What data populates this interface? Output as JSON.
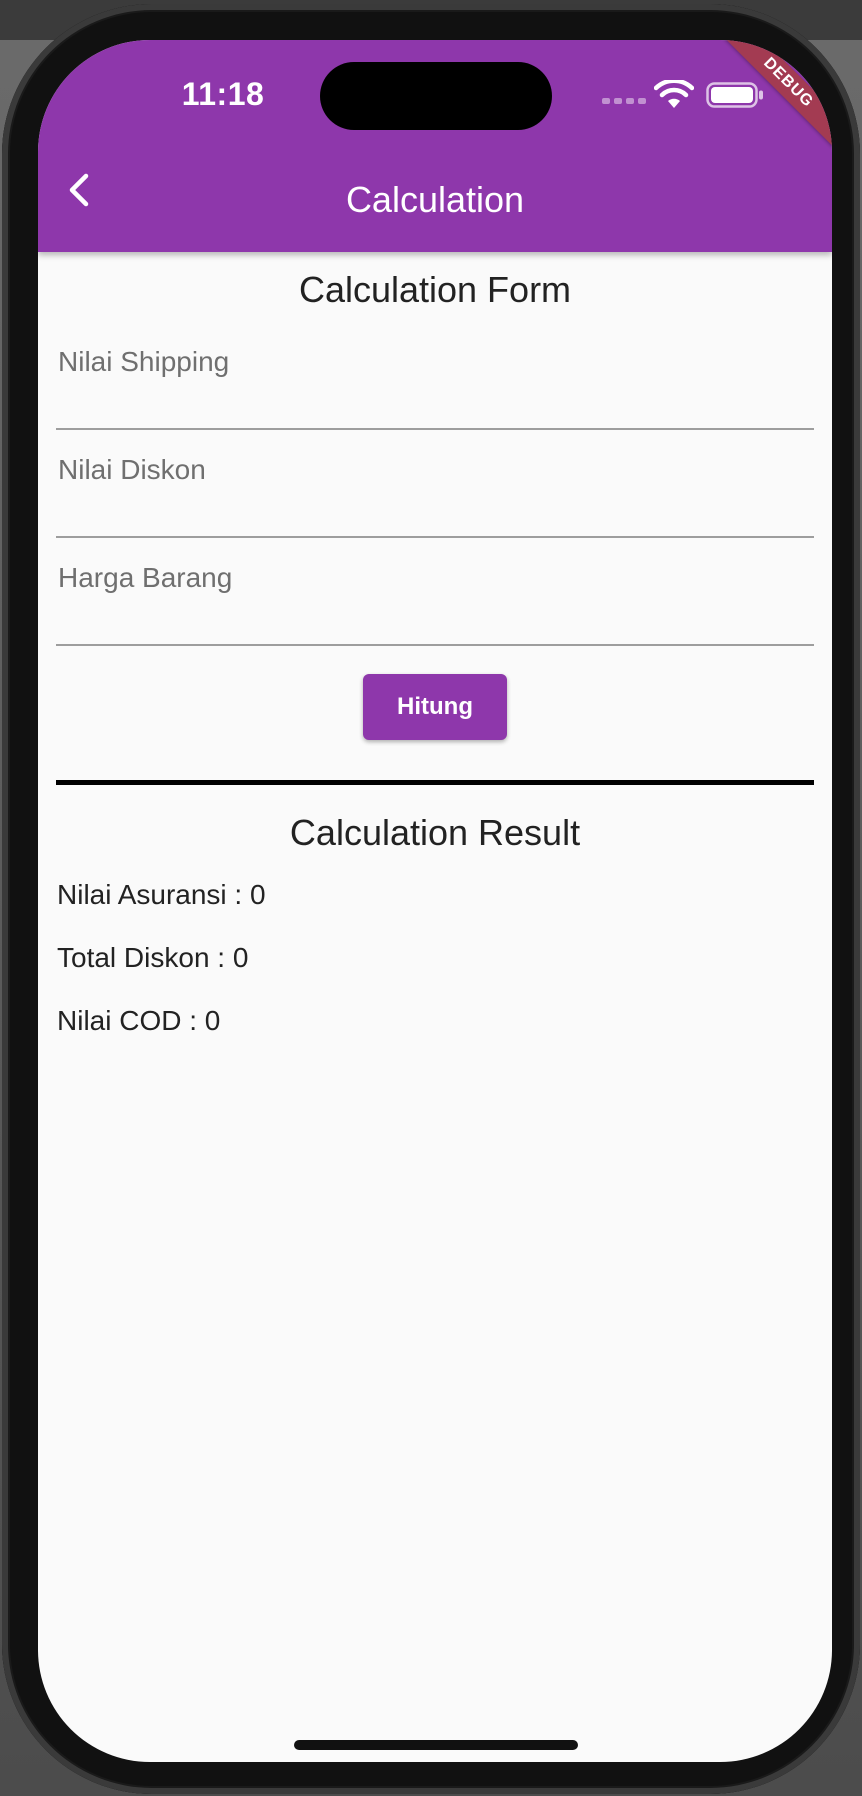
{
  "status_bar": {
    "time": "11:18",
    "debug_label": "DEBUG"
  },
  "app_bar": {
    "title": "Calculation",
    "back_icon": "chevron-left-icon",
    "background_color": "#8e37ab"
  },
  "form": {
    "title": "Calculation Form",
    "fields": [
      {
        "placeholder": "Nilai Shipping",
        "value": ""
      },
      {
        "placeholder": "Nilai Diskon",
        "value": ""
      },
      {
        "placeholder": "Harga Barang",
        "value": ""
      }
    ],
    "submit_label": "Hitung"
  },
  "result": {
    "title": "Calculation Result",
    "lines": [
      "Nilai Asuransi : 0",
      "Total Diskon : 0",
      "Nilai COD : 0"
    ]
  }
}
